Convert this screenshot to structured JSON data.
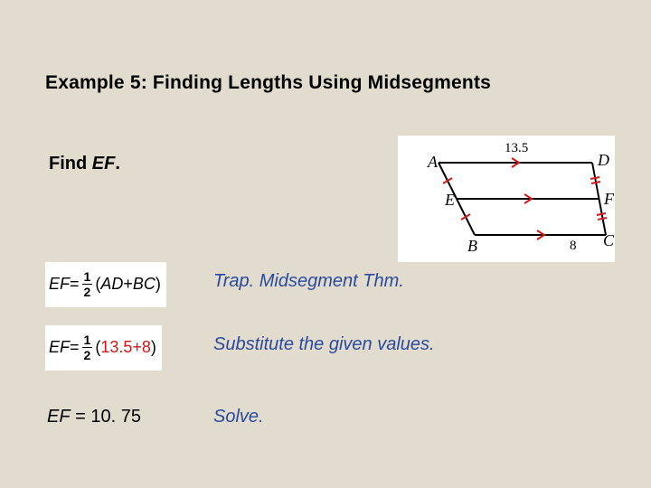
{
  "title": "Example 5: Finding Lengths Using Midsegments",
  "prompt": {
    "pre": "Find ",
    "var": "EF",
    "post": "."
  },
  "diagram": {
    "top_label": "13.5",
    "bottom_label": "8",
    "A": "A",
    "B": "B",
    "C": "C",
    "D": "D",
    "E": "E",
    "F": "F"
  },
  "eq1": {
    "lhs_var": "EF",
    "equals": " = ",
    "frac_num": "1",
    "frac_den": "2",
    "open": "(",
    "t1": "AD",
    "plus": " + ",
    "t2": "BC",
    "close": ")"
  },
  "eq2": {
    "lhs_var": "EF",
    "equals": " = ",
    "frac_num": "1",
    "frac_den": "2",
    "open": "(",
    "v1": "13.5",
    "plus": " + ",
    "v2": "8",
    "close": ")"
  },
  "reasons": {
    "r1": "Trap. Midsegment Thm.",
    "r2": "Substitute the given values.",
    "r3": "Solve."
  },
  "answer": {
    "var": "EF",
    "rest": " = 10. 75"
  }
}
